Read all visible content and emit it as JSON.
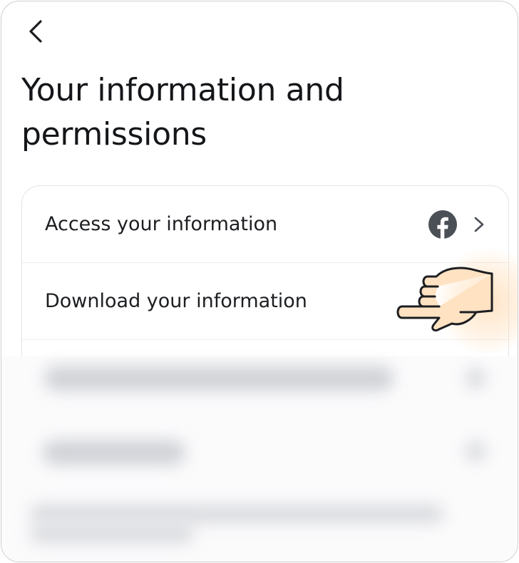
{
  "header": {
    "back_icon": "chevron-left-icon",
    "title": "Your information and permissions"
  },
  "menu": {
    "items": [
      {
        "label": "Access your information",
        "badge_icon": "facebook-icon",
        "trailing_icon": "chevron-right-icon"
      },
      {
        "label": "Download your information"
      }
    ]
  },
  "overlay": {
    "pointer_icon": "hand-pointer-icon",
    "highlight_color": "#ffd9b0"
  },
  "colors": {
    "text": "#1c1e21",
    "icon": "#4b4f56",
    "card_border": "#e3e5ea"
  }
}
